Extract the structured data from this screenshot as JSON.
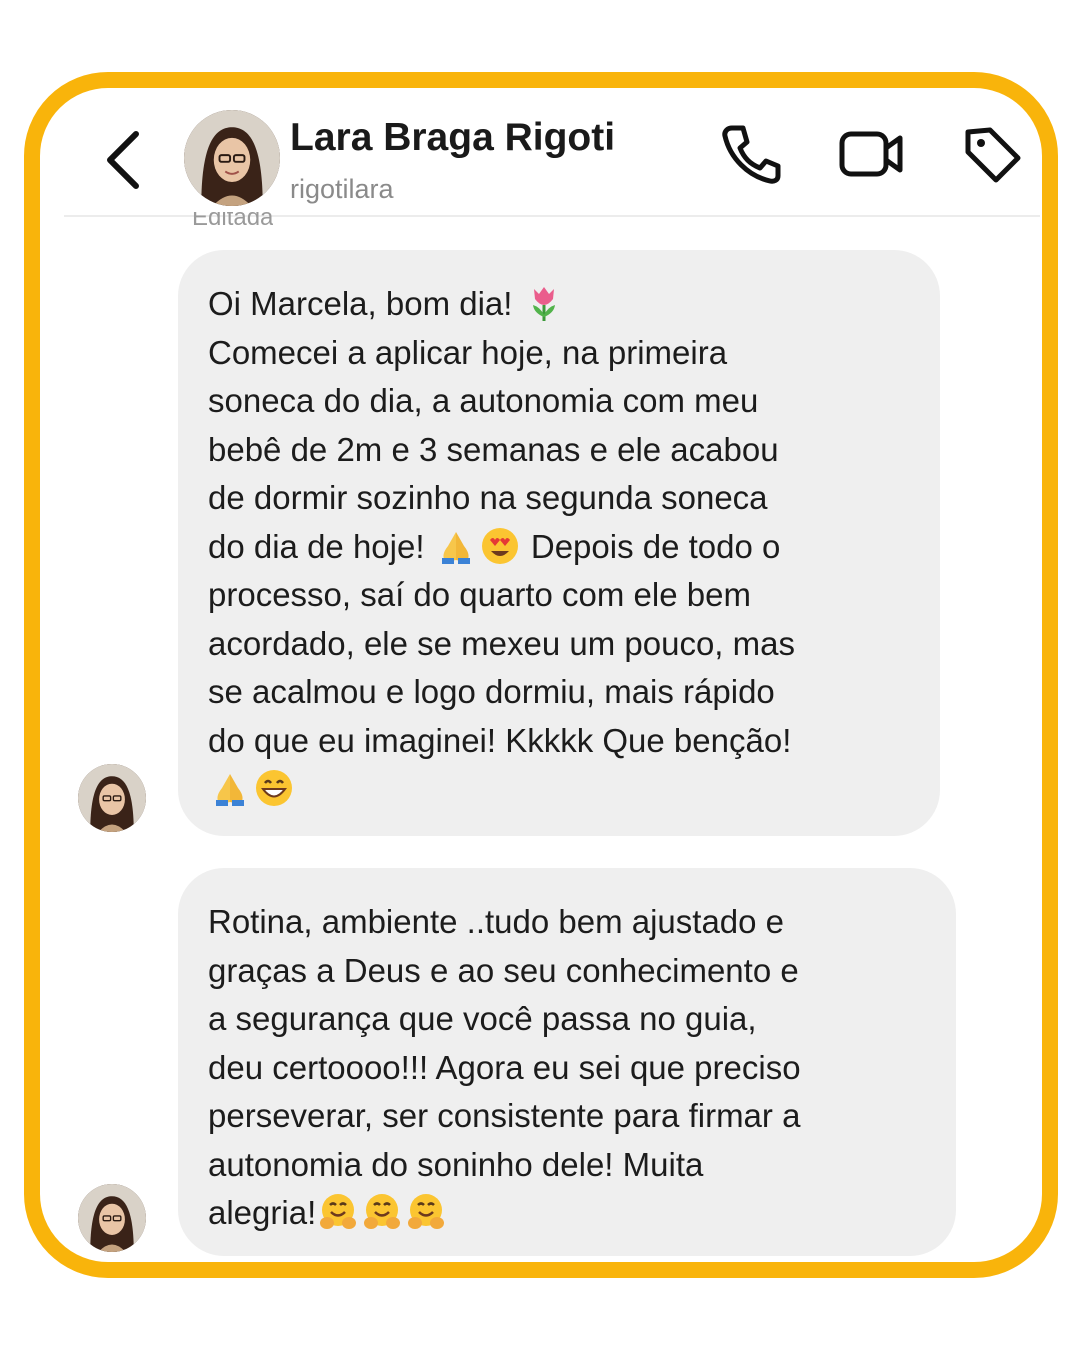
{
  "header": {
    "name": "Lara Braga Rigoti",
    "username": "rigotilara",
    "icons": {
      "back": "chevron-left-icon",
      "call": "phone-icon",
      "video": "video-camera-icon",
      "tag": "tag-icon"
    }
  },
  "status": {
    "edited_label": "Editada"
  },
  "messages": [
    {
      "lines": [
        "Oi Marcela, bom dia! ",
        "Comecei a aplicar hoje, na primeira",
        "soneca do dia, a autonomia com meu",
        "bebê de 2m e 3 semanas e ele acabou",
        "de dormir sozinho na segunda soneca",
        "do dia de hoje! ",
        " Depois de todo o",
        "processo, saí do quarto com ele bem",
        "acordado, ele se mexeu um pouco, mas",
        "se acalmou e logo dormiu, mais rápido",
        "do que eu imaginei! Kkkkk Que benção!"
      ],
      "emojis": [
        "tulip",
        "folded-hands",
        "heart-eyes-face",
        "folded-hands",
        "grinning-face"
      ]
    },
    {
      "lines": [
        "Rotina, ambiente ..tudo bem ajustado e",
        "graças a Deus e ao seu conhecimento e",
        "a segurança que você passa no guia,",
        "deu certoooo!!! Agora eu sei que preciso",
        "perseverar, ser consistente para firmar a",
        "autonomia do soninho dele!  Muita",
        "alegria!"
      ],
      "emojis": [
        "hugging-face",
        "hugging-face",
        "hugging-face"
      ]
    }
  ],
  "colors": {
    "frame_border": "#f9b40b",
    "bubble_bg": "#efefef",
    "text": "#1c1c1c",
    "secondary_text": "#8a8a8a"
  }
}
